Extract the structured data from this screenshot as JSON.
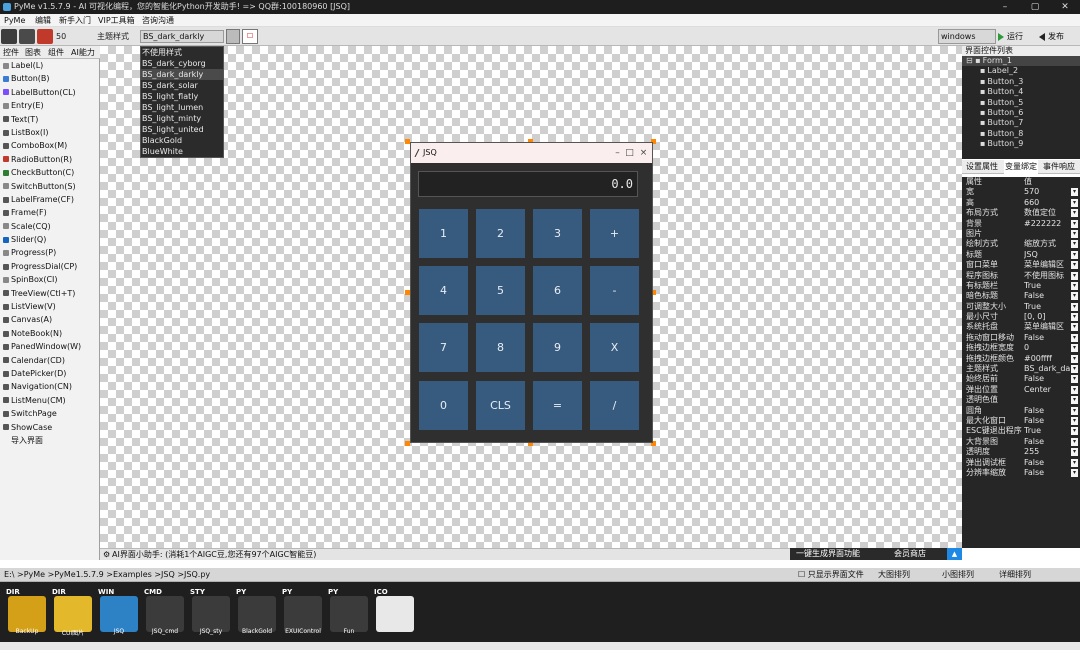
{
  "window": {
    "title": "PyMe v1.5.7.9 - AI 可视化编程，您的智能化Python开发助手! => QQ群:100180960 [JSQ]"
  },
  "menu": [
    "PyMe",
    "编辑",
    "新手入门",
    "VIP工具箱",
    "咨询沟通"
  ],
  "toolbar": {
    "zoom": "50",
    "theme_label": "主题样式",
    "theme_value": "BS_dark_darkly",
    "platform": "windows",
    "run": "运行",
    "publish": "发布"
  },
  "style_options": [
    "不使用样式",
    "BS_dark_cyborg",
    "BS_dark_darkly",
    "BS_dark_solar",
    "BS_light_flatly",
    "BS_light_lumen",
    "BS_light_minty",
    "BS_light_united",
    "BlackGold",
    "BlueWhite"
  ],
  "style_selected_index": 2,
  "left_tabs": [
    "控件",
    "图表",
    "组件",
    "AI能力"
  ],
  "widgets": [
    "Label(L)",
    "Button(B)",
    "LabelButton(CL)",
    "Entry(E)",
    "Text(T)",
    "ListBox(I)",
    "ComboBox(M)",
    "RadioButton(R)",
    "CheckButton(C)",
    "SwitchButton(S)",
    "LabelFrame(CF)",
    "Frame(F)",
    "Scale(CQ)",
    "Slider(Q)",
    "Progress(P)",
    "ProgressDial(CP)",
    "SpinBox(CI)",
    "TreeView(Ctl+T)",
    "ListView(V)",
    "Canvas(A)",
    "NoteBook(N)",
    "PanedWindow(W)",
    "Calendar(CD)",
    "DatePicker(D)",
    "Navigation(CN)",
    "ListMenu(CM)",
    "SwitchPage",
    "ShowCase",
    "导入界面"
  ],
  "form": {
    "title": "JSQ",
    "display": "0.0",
    "keys": [
      "1",
      "2",
      "3",
      "+",
      "4",
      "5",
      "6",
      "-",
      "7",
      "8",
      "9",
      "X",
      "0",
      "CLS",
      "=",
      "/"
    ]
  },
  "right": {
    "tree_title": "界面控件列表",
    "tree": [
      "Form_1",
      "Label_2",
      "Button_3",
      "Button_4",
      "Button_5",
      "Button_6",
      "Button_7",
      "Button_8",
      "Button_9"
    ],
    "tabs": [
      "设置属性",
      "变量绑定",
      "事件响应"
    ],
    "prop_header": {
      "name": "属性",
      "value": "值"
    },
    "props": [
      {
        "n": "宽",
        "v": "570"
      },
      {
        "n": "高",
        "v": "660"
      },
      {
        "n": "布局方式",
        "v": "数值定位"
      },
      {
        "n": "背景",
        "v": "#222222"
      },
      {
        "n": "图片",
        "v": ""
      },
      {
        "n": "绘制方式",
        "v": "缩放方式"
      },
      {
        "n": "标题",
        "v": "JSQ"
      },
      {
        "n": "窗口菜单",
        "v": "菜单编辑区"
      },
      {
        "n": "程序图标",
        "v": "不使用图标"
      },
      {
        "n": "有标题栏",
        "v": "True"
      },
      {
        "n": "暗色标题",
        "v": "False"
      },
      {
        "n": "可调整大小",
        "v": "True"
      },
      {
        "n": "最小尺寸",
        "v": "[0, 0]"
      },
      {
        "n": "系统托盘",
        "v": "菜单编辑区"
      },
      {
        "n": "拖动窗口移动",
        "v": "False"
      },
      {
        "n": "拖拽边框宽度",
        "v": "0"
      },
      {
        "n": "拖拽边框颜色",
        "v": "#00ffff"
      },
      {
        "n": "主题样式",
        "v": "BS_dark_darkly"
      },
      {
        "n": "始终居前",
        "v": "False"
      },
      {
        "n": "弹出位置",
        "v": "Center"
      },
      {
        "n": "透明色值",
        "v": ""
      },
      {
        "n": "圆角",
        "v": "False"
      },
      {
        "n": "最大化窗口",
        "v": "False"
      },
      {
        "n": "ESC键退出程序",
        "v": "True"
      },
      {
        "n": "大背景图",
        "v": "False"
      },
      {
        "n": "透明度",
        "v": "255"
      },
      {
        "n": "弹出调试框",
        "v": "False"
      },
      {
        "n": "分辨率缩放",
        "v": "False"
      }
    ]
  },
  "status": {
    "ai_text": "AI界面小助手: (消耗1个AIGC豆,您还有97个AIGC智能豆)",
    "generate": "一键生成界面功能",
    "vip": "会员商店"
  },
  "path": {
    "text": "E:\\ >PyMe >PyMe1.5.7.9 >Examples >JSQ >JSQ.py",
    "only_ui": "只显示界面文件",
    "large": "大图排列",
    "small": "小图排列",
    "detail": "详细排列"
  },
  "files": [
    {
      "type": "DIR",
      "name": "BackUp",
      "color": "#d4a017"
    },
    {
      "type": "DIR",
      "name": "CUI图片",
      "color": "#e3b92b"
    },
    {
      "type": "WIN",
      "name": "JSQ",
      "color": "#2d82c6"
    },
    {
      "type": "CMD",
      "name": "JSQ_cmd",
      "color": "#3b3b3b"
    },
    {
      "type": "STY",
      "name": "JSQ_sty",
      "color": "#3b3b3b"
    },
    {
      "type": "PY",
      "name": "BlackGold",
      "color": "#3b3b3b"
    },
    {
      "type": "PY",
      "name": "EXUIControl",
      "color": "#3b3b3b"
    },
    {
      "type": "PY",
      "name": "Fun",
      "color": "#3b3b3b"
    },
    {
      "type": "ICO",
      "name": "",
      "color": "#e8e8e8"
    }
  ],
  "colors": {
    "accent": "#375a7f",
    "form_bg": "#2f2f2f",
    "handle": "#ff8800"
  }
}
